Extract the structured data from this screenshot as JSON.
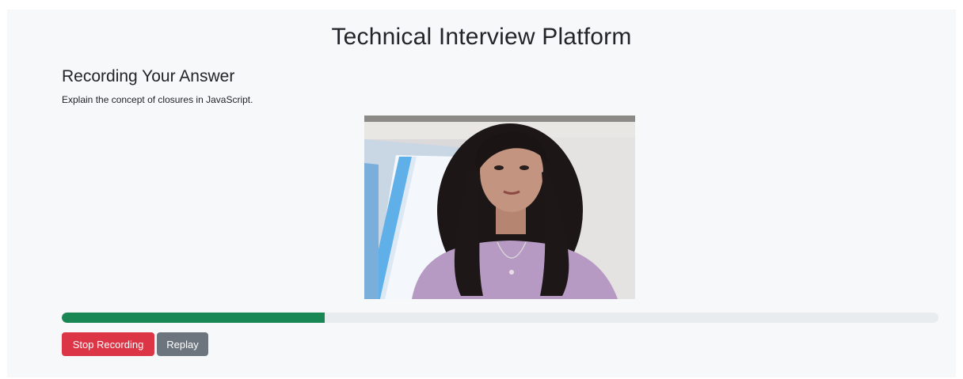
{
  "header": {
    "title": "Technical Interview Platform"
  },
  "recording": {
    "heading": "Recording Your Answer",
    "question": "Explain the concept of closures in JavaScript."
  },
  "video": {
    "description_icon": "webcam-feed"
  },
  "progress": {
    "value_fraction": 0.3,
    "color": "#198754",
    "track_color": "#e9ecef"
  },
  "controls": {
    "stop_label": "Stop Recording",
    "stop_color": "#dc3545",
    "replay_label": "Replay",
    "replay_color": "#6c757d"
  }
}
